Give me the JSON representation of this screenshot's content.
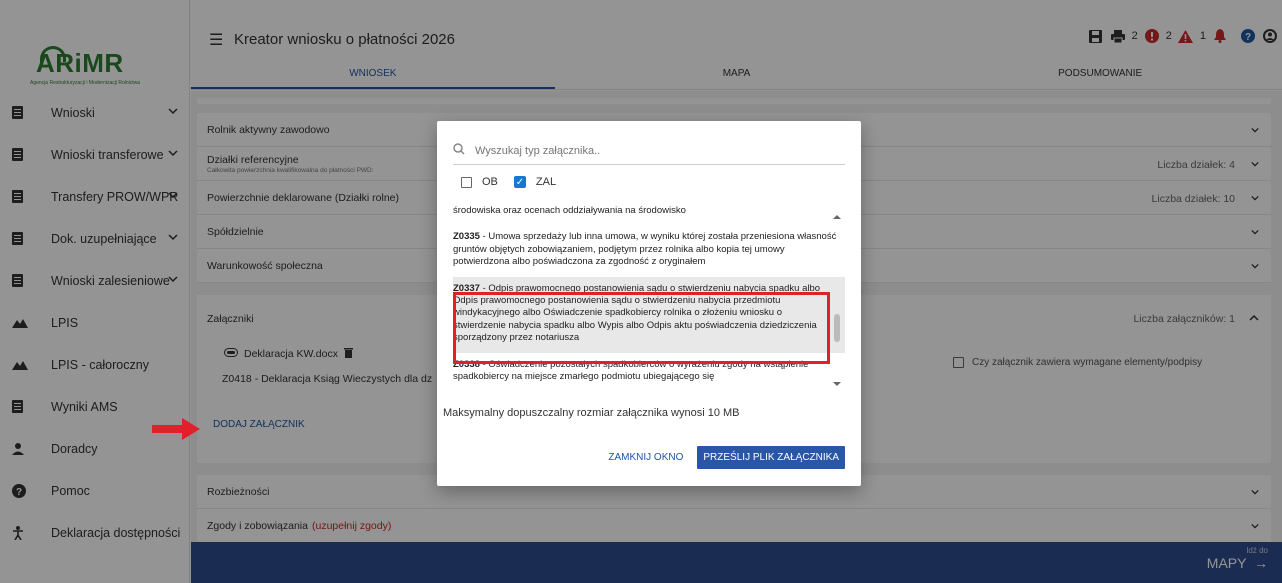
{
  "logo": {
    "name": "ARiMR",
    "subtitle": "Agencja Restrukturyzacji i Modernizacji Rolnictwa"
  },
  "header": {
    "title": "Kreator wniosku o płatności 2026",
    "print_count": "2",
    "warnings_count": "2",
    "alerts_count": "1"
  },
  "tabs": [
    {
      "label": "WNIOSEK"
    },
    {
      "label": "MAPA"
    },
    {
      "label": "PODSUMOWANIE"
    }
  ],
  "sidebar": {
    "items": [
      {
        "label": "Wnioski",
        "icon": "document-icon",
        "has_chevron": true
      },
      {
        "label": "Wnioski transferowe",
        "icon": "document-icon",
        "has_chevron": true
      },
      {
        "label": "Transfery PROW/WPR",
        "icon": "document-icon",
        "has_chevron": true
      },
      {
        "label": "Dok. uzupełniające",
        "icon": "document-icon",
        "has_chevron": true
      },
      {
        "label": "Wnioski zalesieniowe",
        "icon": "document-icon",
        "has_chevron": true
      },
      {
        "label": "LPIS",
        "icon": "terrain-icon",
        "has_chevron": false
      },
      {
        "label": "LPIS - całoroczny",
        "icon": "terrain-icon",
        "has_chevron": false
      },
      {
        "label": "Wyniki AMS",
        "icon": "document-icon",
        "has_chevron": false
      },
      {
        "label": "Doradcy",
        "icon": "person-icon",
        "has_chevron": false
      },
      {
        "label": "Pomoc",
        "icon": "help-icon",
        "has_chevron": false
      },
      {
        "label": "Deklaracja dostępności",
        "icon": "accessibility-icon",
        "has_chevron": false
      }
    ]
  },
  "sections": [
    {
      "label": "Rolnik aktywny zawodowo",
      "sub": "",
      "right": ""
    },
    {
      "label": "Działki referencyjne",
      "sub": "Całkowita powierzchnia kwalifikowalna do płatności PWD:",
      "right": "Liczba działek: 4"
    },
    {
      "label": "Powierzchnie deklarowane (Działki rolne)",
      "sub": "",
      "right": "Liczba działek: 10"
    },
    {
      "label": "Spółdzielnie",
      "sub": "",
      "right": ""
    },
    {
      "label": "Warunkowość społeczna",
      "sub": "",
      "right": ""
    }
  ],
  "attachments": {
    "label": "Załączniki",
    "count_text": "Liczba załączników: 1",
    "file_name": "Deklaracja KW.docx",
    "file_type": "Z0418 - Deklaracja Ksiąg Wieczystych dla dz",
    "checkbox_label": "Czy załącznik zawiera wymagane elementy/podpisy",
    "add_label": "DODAJ ZAŁĄCZNIK"
  },
  "bottom_sections": [
    {
      "label": "Rozbieżności",
      "extra": ""
    },
    {
      "label": "Zgody i zobowiązania",
      "extra": "(uzupełnij zgody)"
    }
  ],
  "footer": {
    "small": "Idź do",
    "label": "MAPY"
  },
  "modal": {
    "search_placeholder": "Wyszukaj typ załącznika..",
    "filter_ob": "OB",
    "filter_zal": "ZAL",
    "filter_ob_checked": false,
    "filter_zal_checked": true,
    "items": [
      {
        "code": "",
        "text": "środowiska oraz ocenach oddziaływania na środowisko"
      },
      {
        "code": "Z0335",
        "text": " - Umowa sprzedaży lub inna umowa, w wyniku której została przeniesiona własność gruntów objętych zobowiązaniem, podjętym przez rolnika albo kopia tej umowy potwierdzona albo poświadczona za zgodność z oryginałem"
      },
      {
        "code": "Z0337",
        "text": " - Odpis prawomocnego postanowienia sądu o stwierdzeniu nabycia spadku albo Odpis prawomocnego postanowienia sądu o stwierdzeniu nabycia przedmiotu windykacyjnego albo Oświadczenie spadkobiercy rolnika o złożeniu wniosku o stwierdzenie nabycia spadku albo Wypis albo Odpis aktu poświadczenia dziedziczenia sporządzony przez notariusza"
      },
      {
        "code": "Z0338",
        "text": " - Oświadczenie pozostałych spadkobierców o wyrażeniu zgody na wstąpienie spadkobiercy na miejsce zmarłego podmiotu ubiegającego się"
      }
    ],
    "max_size_text": "Maksymalny dopuszczalny rozmiar załącznika wynosi 10 MB",
    "close_label": "ZAMKNIJ OKNO",
    "upload_label": "PRZEŚLIJ PLIK ZAŁĄCZNIKA"
  },
  "colors": {
    "accent": "#1e56a0",
    "highlight": "#e0202a",
    "brand_green": "#2e7d32",
    "footer_blue": "#2f4c8f"
  }
}
